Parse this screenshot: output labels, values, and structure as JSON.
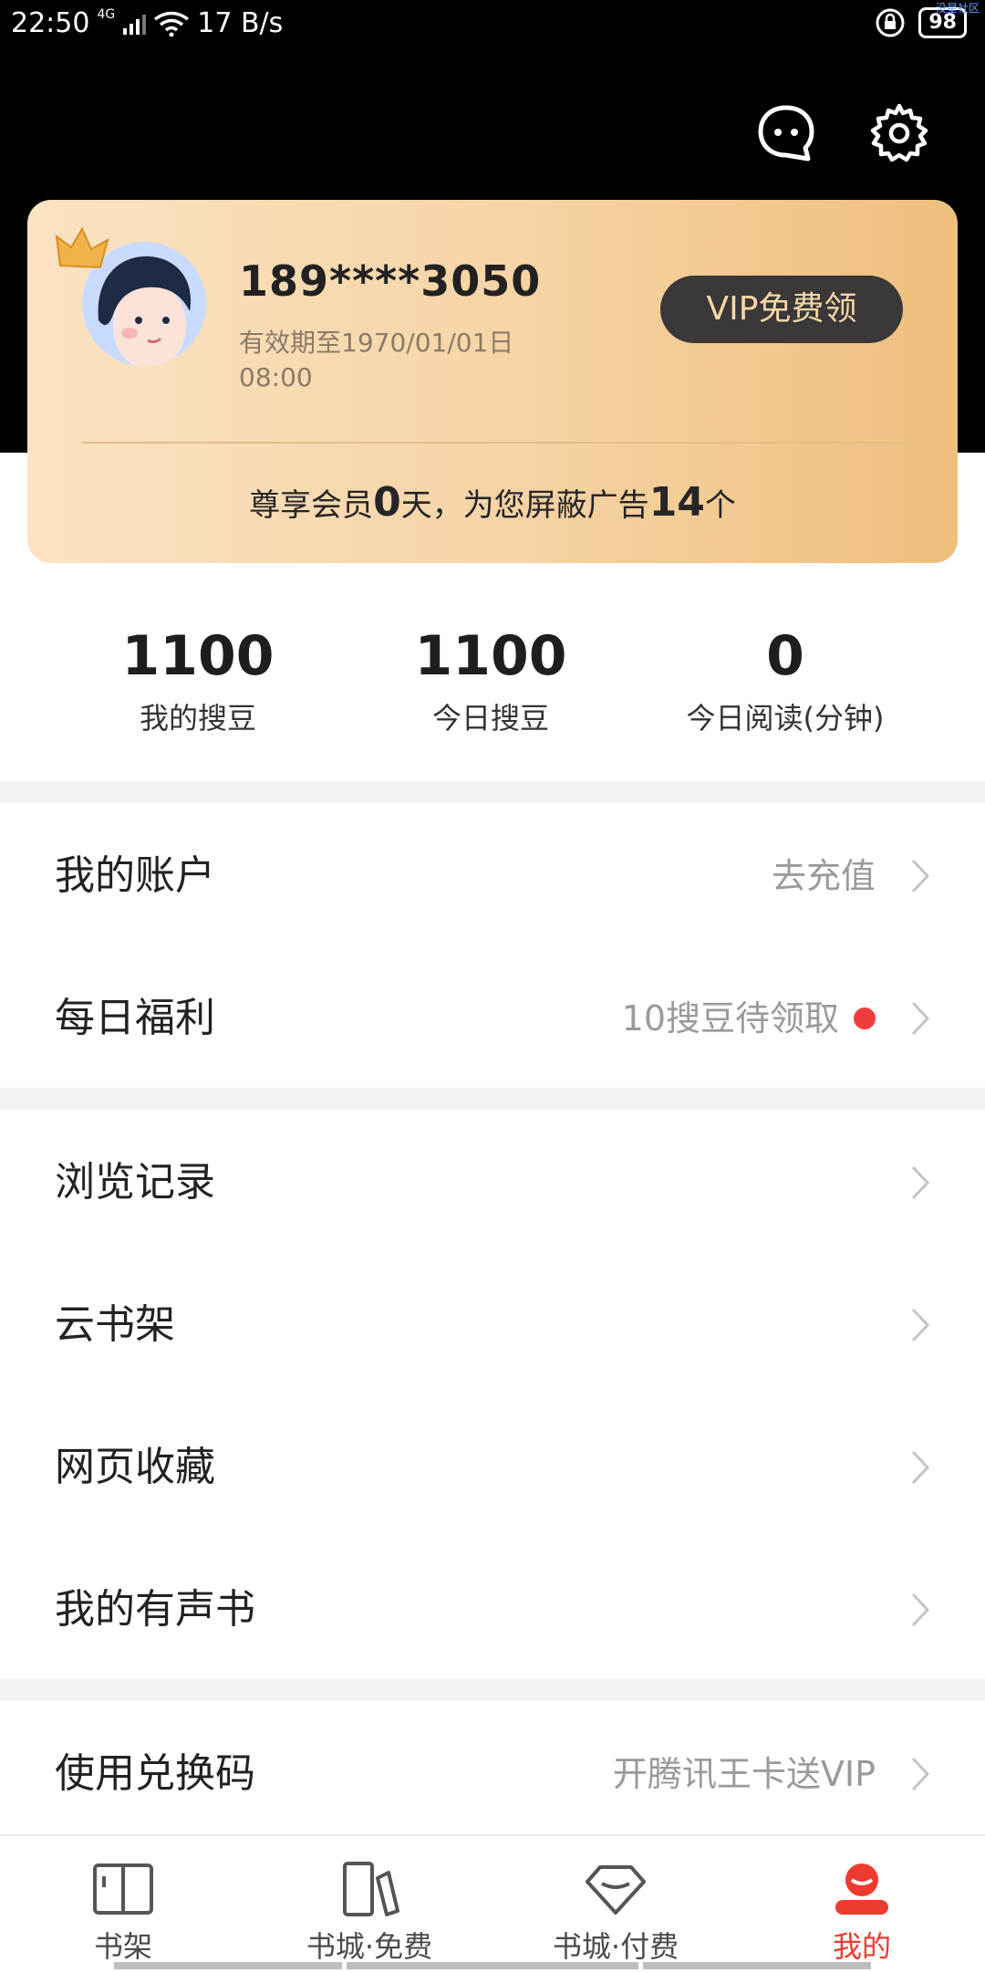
{
  "status_bar": {
    "time": "22:50",
    "network": "4G",
    "speed": "17 B/s",
    "battery": "98",
    "watermark": "没星社区"
  },
  "header": {
    "icons": [
      "chat-icon",
      "settings-icon"
    ]
  },
  "vip_card": {
    "phone": "189****3050",
    "expiry": "有效期至1970/01/01日 08:00",
    "vip_button": "VIP免费领",
    "stats_prefix": "尊享会员",
    "member_days": "0",
    "stats_middle": "天，为您屏蔽广告",
    "ads_blocked": "14",
    "stats_suffix": "个"
  },
  "counters": [
    {
      "value": "1100",
      "label": "我的搜豆"
    },
    {
      "value": "1100",
      "label": "今日搜豆"
    },
    {
      "value": "0",
      "label": "今日阅读(分钟)"
    }
  ],
  "menu": {
    "account": {
      "label": "我的账户",
      "right": "去充值"
    },
    "daily": {
      "label": "每日福利",
      "right": "10搜豆待领取"
    },
    "history": {
      "label": "浏览记录"
    },
    "cloud": {
      "label": "云书架"
    },
    "bookmarks": {
      "label": "网页收藏"
    },
    "audiobooks": {
      "label": "我的有声书"
    },
    "redeem": {
      "label": "使用兑换码",
      "right": "开腾讯王卡送VIP"
    }
  },
  "tabs": [
    {
      "label": "书架",
      "icon": "book-icon"
    },
    {
      "label": "书城·免费",
      "icon": "books-icon"
    },
    {
      "label": "书城·付费",
      "icon": "diamond-icon"
    },
    {
      "label": "我的",
      "icon": "profile-icon"
    }
  ],
  "colors": {
    "accent": "#ee3b2f",
    "vip_gold": "#f6d3a3",
    "vip_button": "#3a3838"
  }
}
